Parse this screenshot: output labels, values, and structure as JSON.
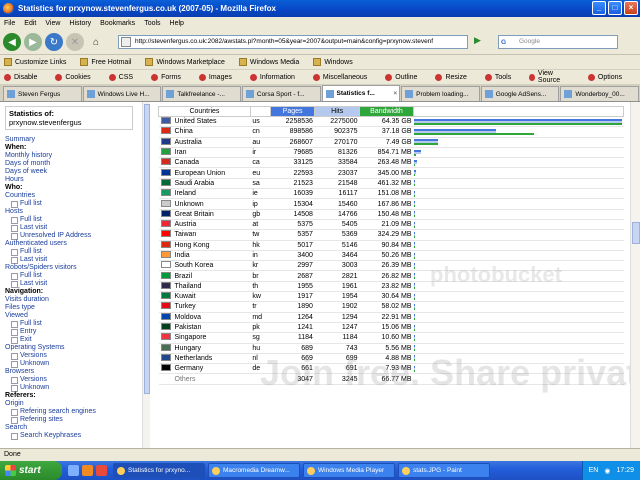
{
  "window": {
    "title": "Statistics for prxynow.stevenfergus.co.uk (2007-05) - Mozilla Firefox"
  },
  "menu": [
    "File",
    "Edit",
    "View",
    "History",
    "Bookmarks",
    "Tools",
    "Help"
  ],
  "address": {
    "url": "http://stevenfergus.co.uk:2082/awstats.pl?month=05&year=2007&output=main&config=prxynow.stevenf",
    "search_placeholder": "Google"
  },
  "bookmarks": [
    "Customize Links",
    "Free Hotmail",
    "Windows Marketplace",
    "Windows Media",
    "Windows"
  ],
  "devbar": [
    "Disable",
    "Cookies",
    "CSS",
    "Forms",
    "Images",
    "Information",
    "Miscellaneous",
    "Outline",
    "Resize",
    "Tools",
    "View Source",
    "Options"
  ],
  "tabs": [
    {
      "label": "Steven Fergus",
      "active": false
    },
    {
      "label": "Windows Live H...",
      "active": false
    },
    {
      "label": "Talkfreelance -...",
      "active": false
    },
    {
      "label": "Corsa Sport - f...",
      "active": false
    },
    {
      "label": "Statistics f...",
      "active": true
    },
    {
      "label": "Problem loading...",
      "active": false
    },
    {
      "label": "Google AdSens...",
      "active": false
    },
    {
      "label": "Wonderboy_00...",
      "active": false
    }
  ],
  "sidebar": {
    "stat_title": "Statistics of:",
    "site": "prxynow.stevenfergus",
    "nav": [
      {
        "type": "link",
        "text": "Summary"
      },
      {
        "type": "head",
        "text": "When:"
      },
      {
        "type": "link",
        "text": "Monthly history"
      },
      {
        "type": "link",
        "text": "Days of month"
      },
      {
        "type": "link",
        "text": "Days of week"
      },
      {
        "type": "link",
        "text": "Hours"
      },
      {
        "type": "head",
        "text": "Who:"
      },
      {
        "type": "link",
        "text": "Countries"
      },
      {
        "type": "sub",
        "text": "Full list"
      },
      {
        "type": "link",
        "text": "Hosts"
      },
      {
        "type": "sub",
        "text": "Full list"
      },
      {
        "type": "sub",
        "text": "Last visit"
      },
      {
        "type": "sub",
        "text": "Unresolved IP Address"
      },
      {
        "type": "link",
        "text": "Authenticated users"
      },
      {
        "type": "sub",
        "text": "Full list"
      },
      {
        "type": "sub",
        "text": "Last visit"
      },
      {
        "type": "link",
        "text": "Robots/Spiders visitors"
      },
      {
        "type": "sub",
        "text": "Full list"
      },
      {
        "type": "sub",
        "text": "Last visit"
      },
      {
        "type": "head",
        "text": "Navigation:"
      },
      {
        "type": "link",
        "text": "Visits duration"
      },
      {
        "type": "link",
        "text": "Files type"
      },
      {
        "type": "link",
        "text": "Viewed"
      },
      {
        "type": "sub",
        "text": "Full list"
      },
      {
        "type": "sub",
        "text": "Entry"
      },
      {
        "type": "sub",
        "text": "Exit"
      },
      {
        "type": "link",
        "text": "Operating Systems"
      },
      {
        "type": "sub",
        "text": "Versions"
      },
      {
        "type": "sub",
        "text": "Unknown"
      },
      {
        "type": "link",
        "text": "Browsers"
      },
      {
        "type": "sub",
        "text": "Versions"
      },
      {
        "type": "sub",
        "text": "Unknown"
      },
      {
        "type": "head",
        "text": "Referers:"
      },
      {
        "type": "link",
        "text": "Origin"
      },
      {
        "type": "sub",
        "text": "Refering search engines"
      },
      {
        "type": "sub",
        "text": "Refering sites"
      },
      {
        "type": "link",
        "text": "Search"
      },
      {
        "type": "sub",
        "text": "Search Keyphrases"
      }
    ]
  },
  "table": {
    "headers": {
      "country": "Countries",
      "pages": "Pages",
      "hits": "Hits",
      "bandwidth": "Bandwidth"
    },
    "rows": [
      {
        "name": "United States",
        "code": "us",
        "pages": "2258536",
        "hits": "2275000",
        "bw": "64.35 GB",
        "p": 2258536,
        "h": 2275000,
        "b": 64.35,
        "color": "#3c5aa6"
      },
      {
        "name": "China",
        "code": "cn",
        "pages": "898586",
        "hits": "902375",
        "bw": "37.18 GB",
        "p": 898586,
        "h": 902375,
        "b": 37.18,
        "color": "#de2910"
      },
      {
        "name": "Australia",
        "code": "au",
        "pages": "268607",
        "hits": "270170",
        "bw": "7.49 GB",
        "p": 268607,
        "h": 270170,
        "b": 7.49,
        "color": "#1f3a8a"
      },
      {
        "name": "Iran",
        "code": "ir",
        "pages": "79685",
        "hits": "81326",
        "bw": "854.71 MB",
        "p": 79685,
        "h": 81326,
        "b": 0.8347,
        "color": "#239f40"
      },
      {
        "name": "Canada",
        "code": "ca",
        "pages": "33125",
        "hits": "33584",
        "bw": "263.48 MB",
        "p": 33125,
        "h": 33584,
        "b": 0.2573,
        "color": "#d52b1e"
      },
      {
        "name": "European Union",
        "code": "eu",
        "pages": "22593",
        "hits": "23037",
        "bw": "345.00 MB",
        "p": 22593,
        "h": 23037,
        "b": 0.3369,
        "color": "#003399"
      },
      {
        "name": "Saudi Arabia",
        "code": "sa",
        "pages": "21523",
        "hits": "21548",
        "bw": "461.32 MB",
        "p": 21523,
        "h": 21548,
        "b": 0.4505,
        "color": "#006c35"
      },
      {
        "name": "Ireland",
        "code": "ie",
        "pages": "16039",
        "hits": "16117",
        "bw": "151.08 MB",
        "p": 16039,
        "h": 16117,
        "b": 0.1475,
        "color": "#169b62"
      },
      {
        "name": "Unknown",
        "code": "ip",
        "pages": "15304",
        "hits": "15460",
        "bw": "167.86 MB",
        "p": 15304,
        "h": 15460,
        "b": 0.1639,
        "color": "#cccccc"
      },
      {
        "name": "Great Britain",
        "code": "gb",
        "pages": "14508",
        "hits": "14766",
        "bw": "150.48 MB",
        "p": 14508,
        "h": 14766,
        "b": 0.147,
        "color": "#012169"
      },
      {
        "name": "Austria",
        "code": "at",
        "pages": "5375",
        "hits": "5405",
        "bw": "21.09 MB",
        "p": 5375,
        "h": 5405,
        "b": 0.0206,
        "color": "#ed2939"
      },
      {
        "name": "Taiwan",
        "code": "tw",
        "pages": "5357",
        "hits": "5369",
        "bw": "324.29 MB",
        "p": 5357,
        "h": 5369,
        "b": 0.3167,
        "color": "#fe0000"
      },
      {
        "name": "Hong Kong",
        "code": "hk",
        "pages": "5017",
        "hits": "5146",
        "bw": "90.84 MB",
        "p": 5017,
        "h": 5146,
        "b": 0.0887,
        "color": "#de2910"
      },
      {
        "name": "India",
        "code": "in",
        "pages": "3400",
        "hits": "3464",
        "bw": "50.26 MB",
        "p": 3400,
        "h": 3464,
        "b": 0.0491,
        "color": "#ff9933"
      },
      {
        "name": "South Korea",
        "code": "kr",
        "pages": "2997",
        "hits": "3003",
        "bw": "26.39 MB",
        "p": 2997,
        "h": 3003,
        "b": 0.0258,
        "color": "#ffffff"
      },
      {
        "name": "Brazil",
        "code": "br",
        "pages": "2687",
        "hits": "2821",
        "bw": "26.82 MB",
        "p": 2687,
        "h": 2821,
        "b": 0.0262,
        "color": "#009c3b"
      },
      {
        "name": "Thailand",
        "code": "th",
        "pages": "1955",
        "hits": "1961",
        "bw": "23.82 MB",
        "p": 1955,
        "h": 1961,
        "b": 0.0233,
        "color": "#2d2a4a"
      },
      {
        "name": "Kuwait",
        "code": "kw",
        "pages": "1917",
        "hits": "1954",
        "bw": "30.64 MB",
        "p": 1917,
        "h": 1954,
        "b": 0.0299,
        "color": "#007a3d"
      },
      {
        "name": "Turkey",
        "code": "tr",
        "pages": "1890",
        "hits": "1902",
        "bw": "58.02 MB",
        "p": 1890,
        "h": 1902,
        "b": 0.0567,
        "color": "#e30a17"
      },
      {
        "name": "Moldova",
        "code": "md",
        "pages": "1264",
        "hits": "1294",
        "bw": "22.91 MB",
        "p": 1264,
        "h": 1294,
        "b": 0.0224,
        "color": "#0046ae"
      },
      {
        "name": "Pakistan",
        "code": "pk",
        "pages": "1241",
        "hits": "1247",
        "bw": "15.06 MB",
        "p": 1241,
        "h": 1247,
        "b": 0.0147,
        "color": "#01411c"
      },
      {
        "name": "Singapore",
        "code": "sg",
        "pages": "1184",
        "hits": "1184",
        "bw": "10.60 MB",
        "p": 1184,
        "h": 1184,
        "b": 0.0104,
        "color": "#ef3340"
      },
      {
        "name": "Hungary",
        "code": "hu",
        "pages": "689",
        "hits": "743",
        "bw": "5.56 MB",
        "p": 689,
        "h": 743,
        "b": 0.0054,
        "color": "#477050"
      },
      {
        "name": "Netherlands",
        "code": "nl",
        "pages": "669",
        "hits": "699",
        "bw": "4.88 MB",
        "p": 669,
        "h": 699,
        "b": 0.0048,
        "color": "#21468b"
      },
      {
        "name": "Germany",
        "code": "de",
        "pages": "661",
        "hits": "691",
        "bw": "7.93 MB",
        "p": 661,
        "h": 691,
        "b": 0.0077,
        "color": "#000000"
      },
      {
        "name": "Others",
        "code": "",
        "pages": "3047",
        "hits": "3245",
        "bw": "66.77 MB",
        "p": 3047,
        "h": 3245,
        "b": 0.0652,
        "color": ""
      }
    ]
  },
  "watermark": {
    "line1": "Join free. Share privately.",
    "line2": "photobucket"
  },
  "status": "Done",
  "taskbar": {
    "start": "start",
    "buttons": [
      "Statistics for prxyno...",
      "Macromedia Dreamw...",
      "Windows Media Player",
      "stats.JPG - Paint"
    ],
    "lang": "EN",
    "clock": "17:29"
  }
}
